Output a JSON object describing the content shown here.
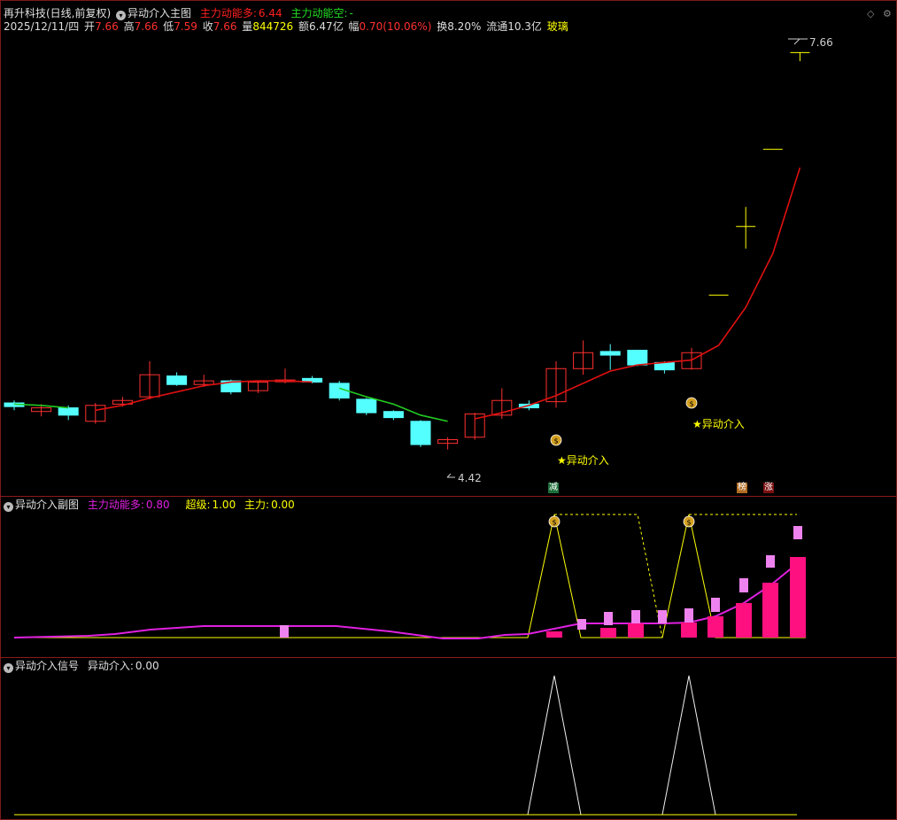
{
  "main": {
    "stock": "再升科技(日线,前复权)",
    "indicator": "异动介入主图",
    "bull_label": "主力动能多:",
    "bull_value": "6.44",
    "bear_label": "主力动能空:",
    "bear_value": "-",
    "date": "2025/12/11/四",
    "open_label": "开",
    "open": "7.66",
    "high_label": "高",
    "high": "7.66",
    "low_label": "低",
    "low": "7.59",
    "close_label": "收",
    "close": "7.66",
    "vol_label": "量",
    "vol": "844726",
    "amt_label": "额",
    "amt": "6.47亿",
    "chg_label": "幅",
    "chg": "0.70(10.06%)",
    "turn_label": "换",
    "turn": "8.20%",
    "float_label": "流通",
    "float": "10.3亿",
    "sector": "玻璃",
    "max_price": "7.66",
    "min_price": "4.42",
    "signal1": "★异动介入",
    "signal2": "★异动介入",
    "badge_jian": "减",
    "badge_bang": "榜",
    "badge_zhang": "涨"
  },
  "sub": {
    "title": "异动介入副图",
    "bull_label": "主力动能多:",
    "bull_value": "0.80",
    "super_label": "超级:",
    "super_value": "1.00",
    "main_label": "主力:",
    "main_value": "0.00"
  },
  "signal": {
    "title": "异动介入信号",
    "label": "异动介入:",
    "value": "0.00"
  },
  "colors": {
    "up": "#ff3030",
    "down": "#54ffff",
    "yellow": "#ffff00",
    "ma_red": "#e01010",
    "ma_green": "#22cc22",
    "magenta": "#e020e0",
    "pink": "#ff1080",
    "lightpink": "#ee82ee"
  },
  "chart_data": {
    "type": "candlestick",
    "ylim": [
      4.2,
      7.8
    ],
    "candles": [
      {
        "o": 4.8,
        "c": 4.77,
        "h": 4.82,
        "l": 4.74
      },
      {
        "o": 4.73,
        "c": 4.76,
        "h": 4.79,
        "l": 4.69
      },
      {
        "o": 4.76,
        "c": 4.7,
        "h": 4.78,
        "l": 4.66
      },
      {
        "o": 4.65,
        "c": 4.78,
        "h": 4.8,
        "l": 4.63
      },
      {
        "o": 4.79,
        "c": 4.82,
        "h": 4.85,
        "l": 4.77
      },
      {
        "o": 4.85,
        "c": 5.03,
        "h": 5.14,
        "l": 4.83
      },
      {
        "o": 5.02,
        "c": 4.95,
        "h": 5.05,
        "l": 4.94
      },
      {
        "o": 4.95,
        "c": 4.98,
        "h": 5.03,
        "l": 4.93
      },
      {
        "o": 4.98,
        "c": 4.89,
        "h": 4.99,
        "l": 4.87
      },
      {
        "o": 4.9,
        "c": 4.97,
        "h": 4.98,
        "l": 4.88
      },
      {
        "o": 4.98,
        "c": 4.98,
        "h": 5.08,
        "l": 4.96
      },
      {
        "o": 5.0,
        "c": 4.97,
        "h": 5.02,
        "l": 4.96
      },
      {
        "o": 4.96,
        "c": 4.84,
        "h": 4.98,
        "l": 4.82
      },
      {
        "o": 4.83,
        "c": 4.72,
        "h": 4.84,
        "l": 4.7
      },
      {
        "o": 4.73,
        "c": 4.68,
        "h": 4.74,
        "l": 4.66
      },
      {
        "o": 4.65,
        "c": 4.46,
        "h": 4.66,
        "l": 4.44
      },
      {
        "o": 4.47,
        "c": 4.5,
        "h": 4.52,
        "l": 4.42
      },
      {
        "o": 4.52,
        "c": 4.71,
        "h": 4.72,
        "l": 4.5
      },
      {
        "o": 4.7,
        "c": 4.82,
        "h": 4.92,
        "l": 4.67
      },
      {
        "o": 4.79,
        "c": 4.76,
        "h": 4.82,
        "l": 4.74
      },
      {
        "o": 4.81,
        "c": 5.08,
        "h": 5.14,
        "l": 4.76
      },
      {
        "o": 5.08,
        "c": 5.21,
        "h": 5.31,
        "l": 5.03
      },
      {
        "o": 5.22,
        "c": 5.19,
        "h": 5.28,
        "l": 5.07
      },
      {
        "o": 5.23,
        "c": 5.11,
        "h": 5.23,
        "l": 5.1
      },
      {
        "o": 5.13,
        "c": 5.07,
        "h": 5.14,
        "l": 5.04
      },
      {
        "o": 5.08,
        "c": 5.21,
        "h": 5.25,
        "l": 5.07
      },
      {
        "o": 5.68,
        "c": 5.68,
        "h": 5.68,
        "l": 5.68
      },
      {
        "o": 6.24,
        "c": 6.24,
        "h": 6.4,
        "l": 6.06
      },
      {
        "o": 6.87,
        "c": 6.87,
        "h": 6.87,
        "l": 6.87
      },
      {
        "o": 7.66,
        "c": 7.66,
        "h": 7.66,
        "l": 7.59
      }
    ]
  }
}
